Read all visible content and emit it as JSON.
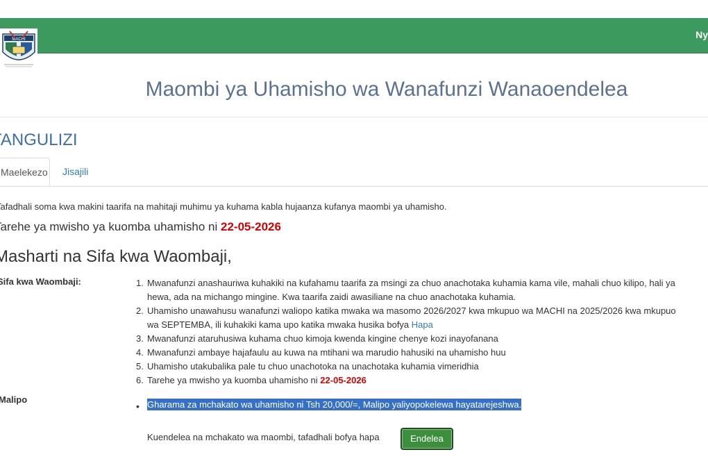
{
  "nav": {
    "right_text": "Ny"
  },
  "logo": {
    "text": "MACHI"
  },
  "page_title": "Maombi ya Uhamisho wa Wanafunzi Wanaoendelea",
  "section_title": "TANGULIZI",
  "tabs": [
    {
      "label": "Maelekezo",
      "active": true
    },
    {
      "label": "Jisajili",
      "active": false
    }
  ],
  "intro": "Tafadhali soma kwa makini taarifa na mahitaji muhimu ya kuhama kabla hujaanza kufanya maombi ya uhamisho.",
  "deadline": {
    "text": "Tarehe ya mwisho ya kuomba uhamisho ni ",
    "date": "22-05-2026"
  },
  "conditions_title": "Masharti na Sifa kwa Waombaji,",
  "eligibility_label": "Sifa kwa Waombaji:",
  "items": [
    {
      "num": "1.",
      "line1": "Mwanafunzi anashauriwa kuhakiki na kufahamu taarifa za msingi za chuo anachotaka kuhamia kama vile, mahali chuo kilipo, hali ya",
      "line2": "hewa, ada na michango mingine. Kwa taarifa zaidi awasiliane na chuo anachotaka kuhamia."
    },
    {
      "num": "2.",
      "line1": "Uhamisho unawahusu wanafunzi waliopo katika mwaka wa masomo 2026/2027 kwa mkupuo wa MACHI na 2025/2026 kwa mkupuo",
      "line2": "wa SEPTEMBA, ili kuhakiki kama upo katika mwaka husika bofya ",
      "link": "Hapa"
    },
    {
      "num": "3.",
      "line1": "Mwanafunzi ataruhusiwa kuhama chuo kimoja kwenda kingine chenye kozi inayofanana"
    },
    {
      "num": "4.",
      "line1": "Mwanafunzi ambaye hajafaulu au kuwa na mtihani wa marudio hahusiki na uhamisho huu"
    },
    {
      "num": "5.",
      "line1": "Uhamisho utakubalika pale tu chuo unachotoka na unachotaka kuhamia vimeridhia"
    },
    {
      "num": "6.",
      "line1": "Tarehe ya mwisho ya kuomba uhamisho ni ",
      "date": "22-05-2026"
    }
  ],
  "payment_label": "Malipo",
  "fee_note": "Gharama za mchakato wa uhamisho ni Tsh 20,000/=, Malipo yaliyopokelewa hayatarejeshwa.",
  "continue_text": "Kuendelea na mchakato wa maombi, tafadhali bofya hapa",
  "continue_button": "Endelea",
  "colors": {
    "navbar": "#3c9a5f",
    "title": "#5b7191",
    "section": "#3f6fa3",
    "deadline": "#d60000",
    "button": "#3c8f3c",
    "highlight": "#3470c8"
  }
}
